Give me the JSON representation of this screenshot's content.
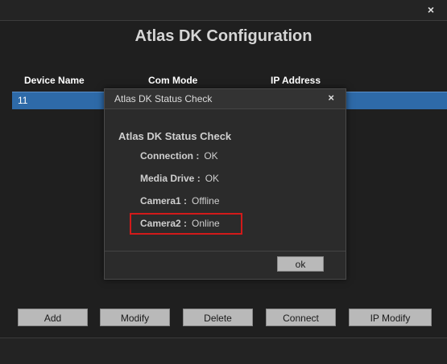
{
  "window": {
    "close_glyph": "×",
    "title": "Atlas DK Configuration"
  },
  "table": {
    "columns": [
      "Device Name",
      "Com Mode",
      "IP Address"
    ],
    "rows": [
      {
        "device_name": "11"
      }
    ]
  },
  "buttons": {
    "add": "Add",
    "modify": "Modify",
    "delete": "Delete",
    "connect": "Connect",
    "ip_modify": "IP Modify"
  },
  "dialog": {
    "title": "Atlas DK Status Check",
    "close_glyph": "×",
    "heading": "Atlas DK Status Check",
    "items": [
      {
        "label": "Connection :",
        "value": "OK"
      },
      {
        "label": "Media Drive :",
        "value": "OK"
      },
      {
        "label": "Camera1 :",
        "value": "Offline"
      },
      {
        "label": "Camera2 :",
        "value": "Online"
      }
    ],
    "ok_label": "ok"
  },
  "colors": {
    "highlight": "#d21a1a",
    "selection": "#2e6aa8"
  }
}
